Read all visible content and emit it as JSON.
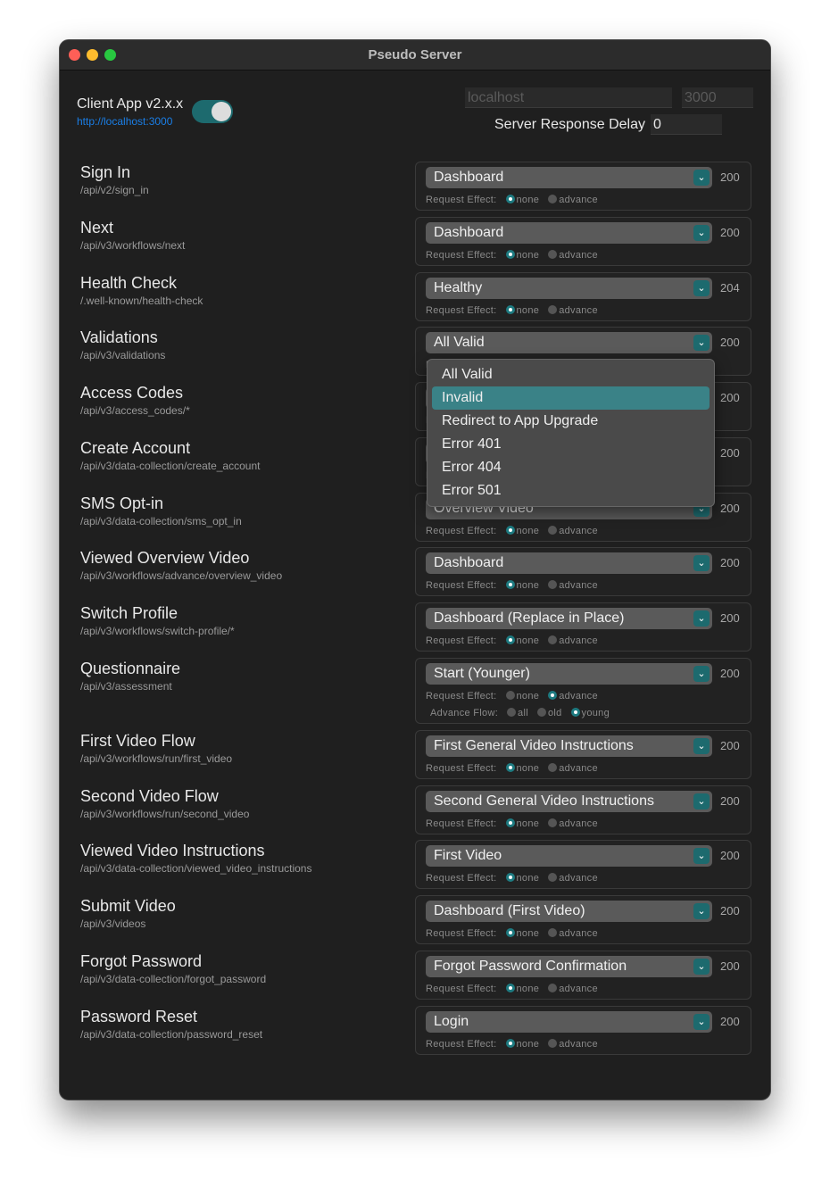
{
  "window": {
    "title": "Pseudo Server"
  },
  "client": {
    "label": "Client App v2.x.x",
    "url": "http://localhost:3000",
    "toggle_on": true
  },
  "server": {
    "host_placeholder": "localhost",
    "port_placeholder": "3000",
    "delay_label": "Server Response Delay",
    "delay_value": "0"
  },
  "labels": {
    "request_effect": "Request Effect:",
    "advance_flow": "Advance Flow:",
    "none": "none",
    "advance": "advance",
    "all": "all",
    "old": "old",
    "young": "young"
  },
  "colors": {
    "accent": "#1d6a6e",
    "highlight": "#3a8287",
    "link": "#1a7ee6"
  },
  "routes": [
    {
      "name": "Sign In",
      "path": "/api/v2/sign_in",
      "response": "Dashboard",
      "status": "200",
      "effect": "none"
    },
    {
      "name": "Next",
      "path": "/api/v3/workflows/next",
      "response": "Dashboard",
      "status": "200",
      "effect": "none"
    },
    {
      "name": "Health Check",
      "path": "/.well-known/health-check",
      "response": "Healthy",
      "status": "204",
      "effect": "none"
    },
    {
      "name": "Validations",
      "path": "/api/v3/validations",
      "response": "All Valid",
      "status": "200",
      "effect": "none"
    },
    {
      "name": "Access Codes",
      "path": "/api/v3/access_codes/*",
      "response": "",
      "status": "200",
      "effect": "none"
    },
    {
      "name": "Create Account",
      "path": "/api/v3/data-collection/create_account",
      "response": "",
      "status": "200",
      "effect": "none"
    },
    {
      "name": "SMS Opt-in",
      "path": "/api/v3/data-collection/sms_opt_in",
      "response": "Overview Video",
      "status": "200",
      "effect": "none"
    },
    {
      "name": "Viewed Overview Video",
      "path": "/api/v3/workflows/advance/overview_video",
      "response": "Dashboard",
      "status": "200",
      "effect": "none"
    },
    {
      "name": "Switch Profile",
      "path": "/api/v3/workflows/switch-profile/*",
      "response": "Dashboard (Replace in Place)",
      "status": "200",
      "effect": "none"
    },
    {
      "name": "Questionnaire",
      "path": "/api/v3/assessment",
      "response": "Start (Younger)",
      "status": "200",
      "effect": "advance",
      "flow": "young"
    },
    {
      "name": "First Video Flow",
      "path": "/api/v3/workflows/run/first_video",
      "response": "First General Video Instructions",
      "status": "200",
      "effect": "none"
    },
    {
      "name": "Second Video Flow",
      "path": "/api/v3/workflows/run/second_video",
      "response": "Second General Video Instructions",
      "status": "200",
      "effect": "none"
    },
    {
      "name": "Viewed Video Instructions",
      "path": "/api/v3/data-collection/viewed_video_instructions",
      "response": "First Video",
      "status": "200",
      "effect": "none"
    },
    {
      "name": "Submit Video",
      "path": "/api/v3/videos",
      "response": "Dashboard (First Video)",
      "status": "200",
      "effect": "none"
    },
    {
      "name": "Forgot Password",
      "path": "/api/v3/data-collection/forgot_password",
      "response": "Forgot Password Confirmation",
      "status": "200",
      "effect": "none"
    },
    {
      "name": "Password Reset",
      "path": "/api/v3/data-collection/password_reset",
      "response": "Login",
      "status": "200",
      "effect": "none"
    }
  ],
  "dropdown": {
    "options": [
      "All Valid",
      "Invalid",
      "Redirect to App Upgrade",
      "Error 401",
      "Error 404",
      "Error 501"
    ],
    "highlighted": "Invalid"
  }
}
